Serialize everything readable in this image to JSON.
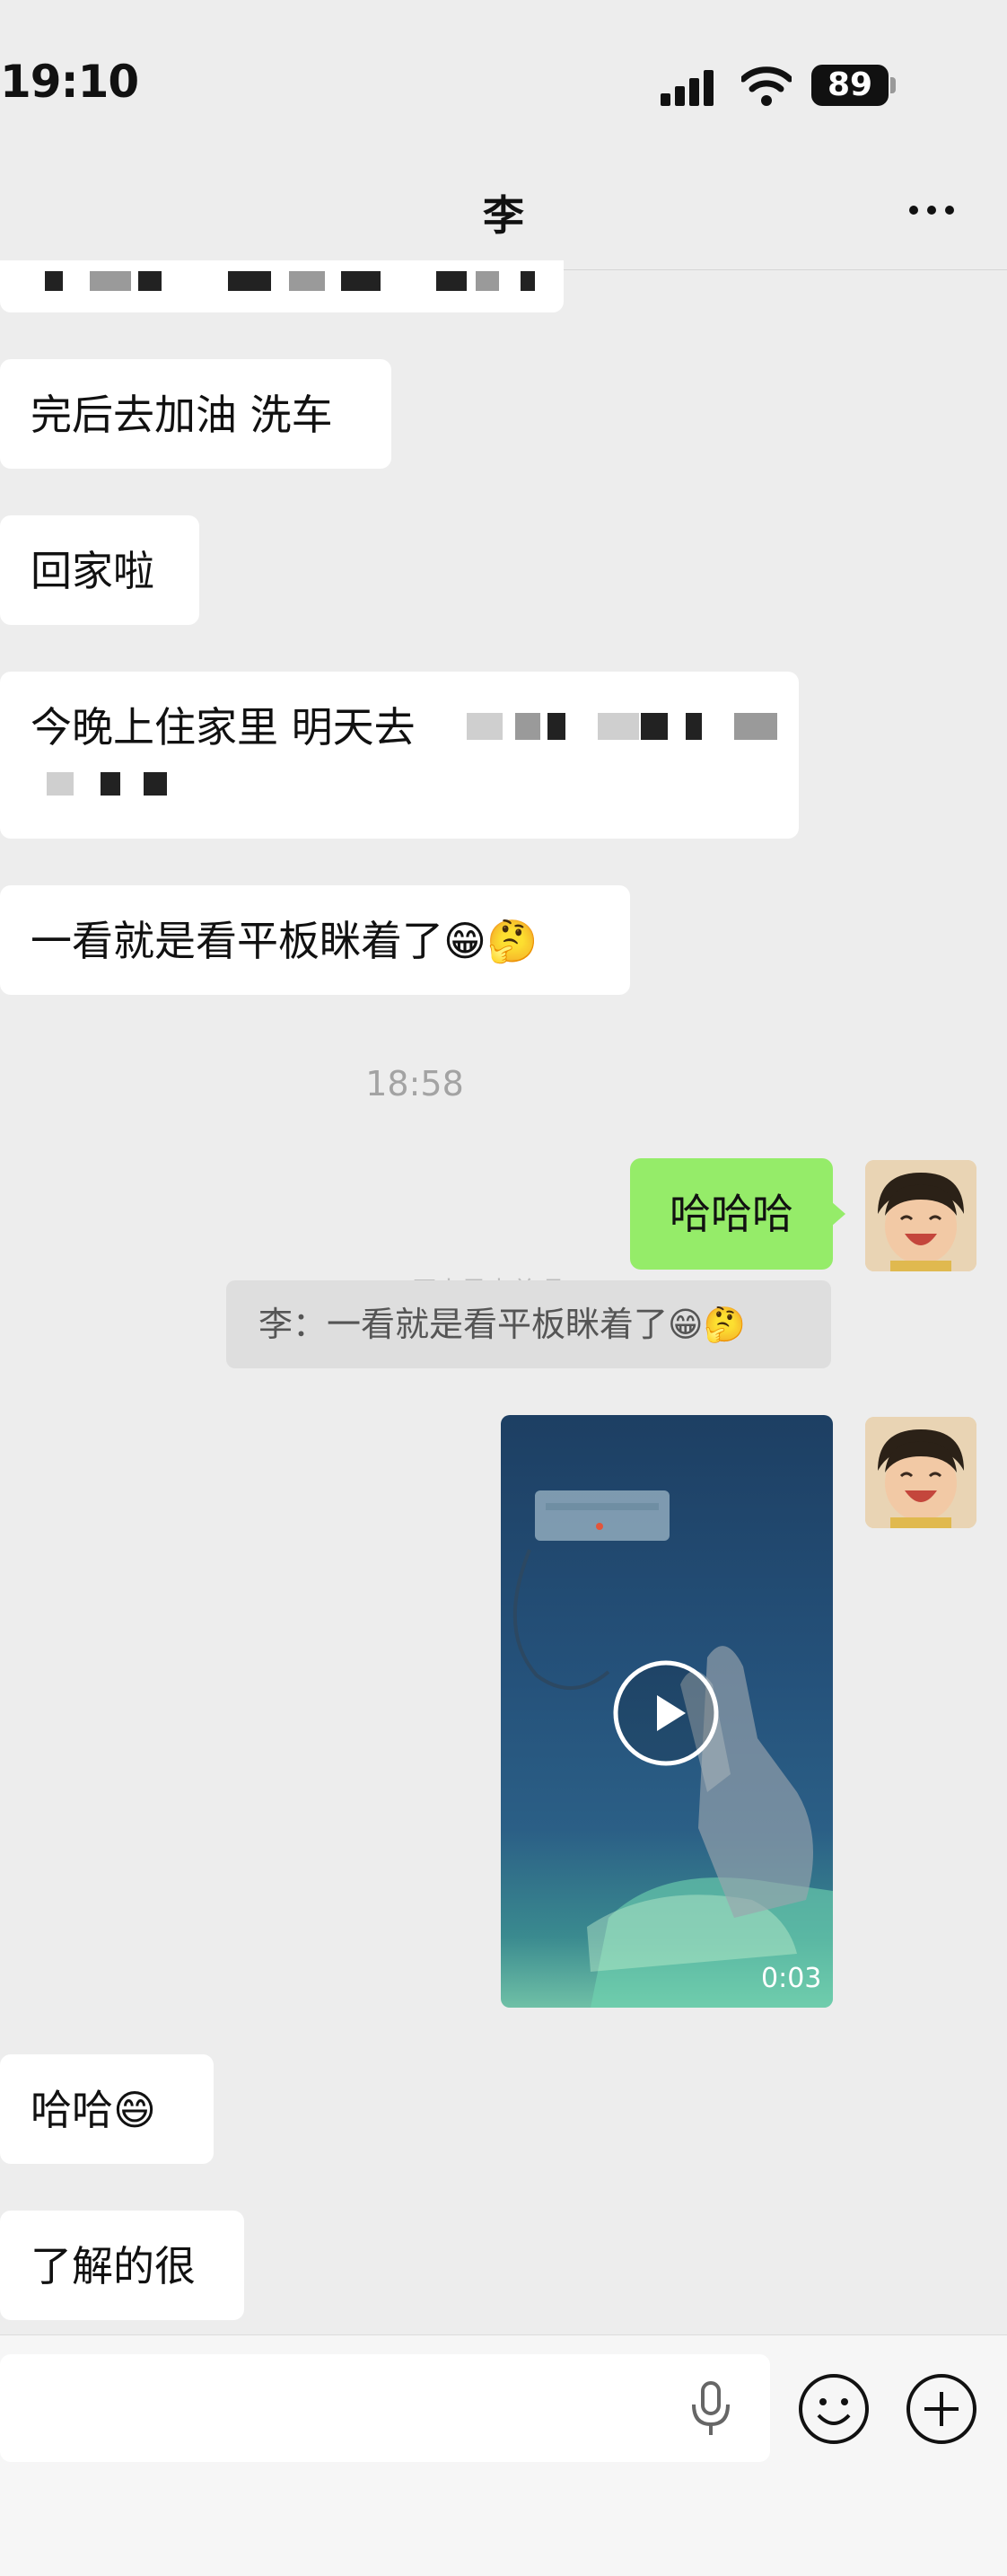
{
  "status_bar": {
    "time": "19:10",
    "battery": "89"
  },
  "header": {
    "title": "李"
  },
  "messages": [
    {
      "text": "完后去加油 洗车"
    },
    {
      "text": "回家啦"
    },
    {
      "text": "今晚上住家里 明天去"
    },
    {
      "text": "一看就是看平板眯着了😁🤔"
    },
    {
      "text": "哈哈😄"
    },
    {
      "text": "了解的很"
    }
  ],
  "timestamp": "18:58",
  "my_reply": {
    "text": "哈哈哈"
  },
  "quote": {
    "text": "李：一看就是看平板眯着了😁🤔"
  },
  "watermark": "@原来是李总呀",
  "video": {
    "duration": "0:03"
  },
  "colors": {
    "my_bubble": "#95ec69",
    "background": "#ededed"
  }
}
